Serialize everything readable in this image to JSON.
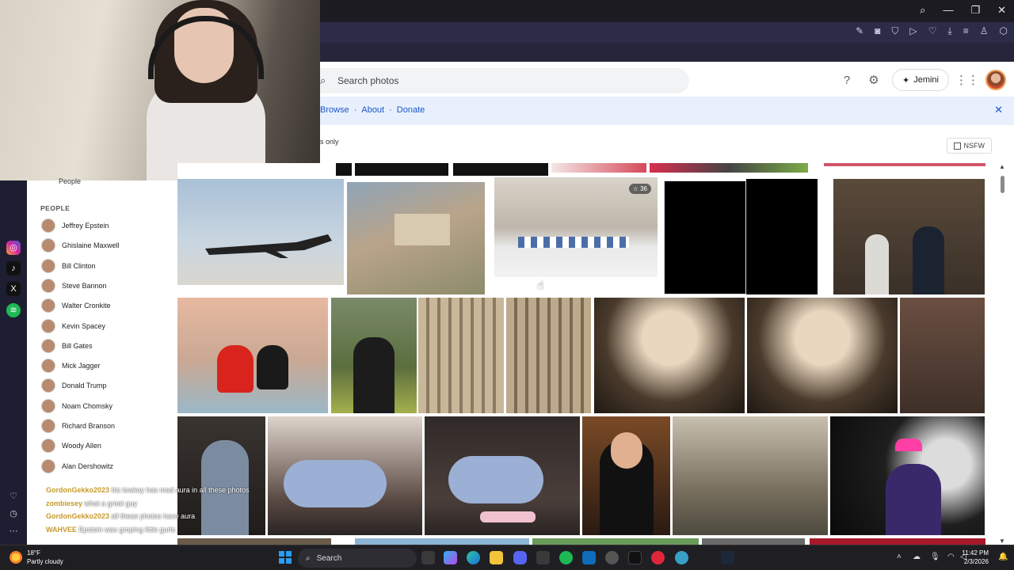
{
  "site": {
    "search_placeholder": "Search photos",
    "gemini_label": "Jemini",
    "banner_links": [
      "Browse",
      "About",
      "Donate"
    ],
    "filter_text": "s only",
    "nsfw_label": "NSFW"
  },
  "sidebar": {
    "top_label": "People",
    "heading": "PEOPLE",
    "people": [
      "Jeffrey Epstein",
      "Ghislaine Maxwell",
      "Bill Clinton",
      "Steve Bannon",
      "Walter Cronkite",
      "Kevin Spacey",
      "Bill Gates",
      "Mick Jagger",
      "Donald Trump",
      "Noam Chomsky",
      "Richard Branson",
      "Woody Allen",
      "Alan Dershowitz"
    ]
  },
  "chat": [
    {
      "user": "GordonGekko2023",
      "message": "his lowkey has mad aura in all these photos"
    },
    {
      "user": "zombiesey",
      "message": "what a great guy"
    },
    {
      "user": "GordonGekko2023",
      "message": "all these photos have aura"
    },
    {
      "user": "WAHVEE",
      "message": "Epstein was groping little gurls"
    }
  ],
  "grid": {
    "album_count_badge": "36"
  },
  "taskbar": {
    "temperature": "18°F",
    "weather": "Partly cloudy",
    "search_label": "Search",
    "time": "11:42 PM",
    "date": "2/3/2026"
  },
  "colors": {
    "link_blue": "#1a56c8",
    "banner_bg": "#e8f0fe",
    "chat_user": "#c79a2c"
  }
}
